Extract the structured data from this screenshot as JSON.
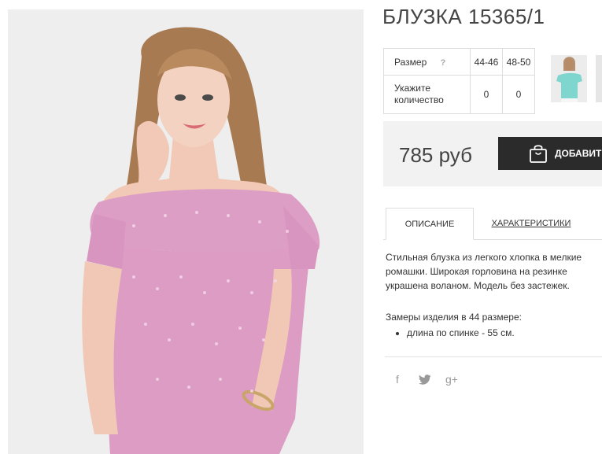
{
  "product": {
    "title": "БЛУЗКА 15365/1",
    "main_image_icon": "product-photo",
    "thumbnail_icon": "product-thumbnail"
  },
  "sizes": {
    "size_label": "Размер",
    "help": "?",
    "qty_label_line1": "Укажите",
    "qty_label_line2": "количество",
    "columns": [
      {
        "size": "44-46",
        "qty": "0"
      },
      {
        "size": "48-50",
        "qty": "0"
      }
    ]
  },
  "purchase": {
    "price": "785 руб",
    "add_label": "ДОБАВИТЬ",
    "colors": {
      "button": "#2b2b2b",
      "panel": "#f2f2f2"
    }
  },
  "tabs": {
    "description": "ОПИСАНИЕ",
    "specs": "ХАРАКТЕРИСТИКИ",
    "active": "description"
  },
  "description": {
    "line1": "Стильная блузка из легкого хлопка в мелкие",
    "line2": "ромашки. Широкая горловина на резинке",
    "line3": "украшена воланом. Модель без застежек.",
    "measure_title": "Замеры изделия в 44 размере:",
    "measure_items": [
      "длина по спинке - 55 см."
    ]
  },
  "social": {
    "facebook": "f",
    "twitter": "twitter-bird-icon",
    "google": "g+"
  }
}
